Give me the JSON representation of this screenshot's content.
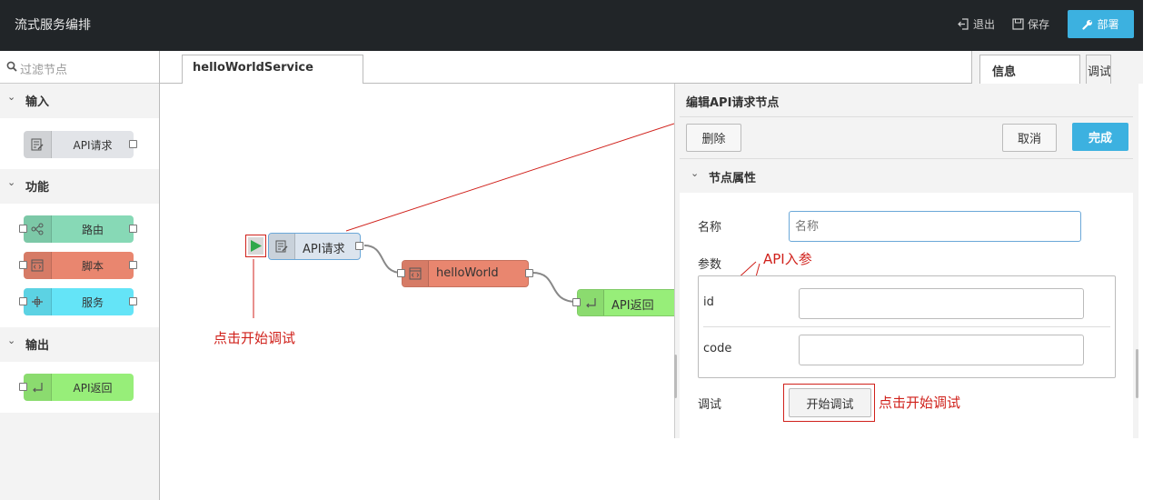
{
  "header": {
    "title": "流式服务编排",
    "logout_label": "退出",
    "save_label": "保存",
    "deploy_label": "部署"
  },
  "palette": {
    "filter_placeholder": "过滤节点",
    "categories": [
      {
        "label": "输入",
        "nodes": [
          {
            "label": "API请求",
            "icon": "api-request-icon",
            "color": "#e2e4e8"
          }
        ]
      },
      {
        "label": "功能",
        "nodes": [
          {
            "label": "路由",
            "icon": "route-icon",
            "color": "#87d9b6"
          },
          {
            "label": "脚本",
            "icon": "script-icon",
            "color": "#e9866f"
          },
          {
            "label": "服务",
            "icon": "service-icon",
            "color": "#64e4f7"
          }
        ]
      },
      {
        "label": "输出",
        "nodes": [
          {
            "label": "API返回",
            "icon": "api-return-icon",
            "color": "#97ee79"
          }
        ]
      }
    ]
  },
  "workspace": {
    "tab_label": "helloWorldService",
    "nodes": [
      {
        "label": "API请求",
        "color": "#dbe4ee"
      },
      {
        "label": "helloWorld",
        "color": "#e9866f"
      },
      {
        "label": "API返回",
        "color": "#97ee79"
      }
    ],
    "annotation_start": "点击开始调试"
  },
  "sidebar": {
    "tab_info": "信息",
    "tab_debug": "调试",
    "tray_title": "编辑API请求节点",
    "delete_label": "删除",
    "cancel_label": "取消",
    "done_label": "完成",
    "props_header": "节点属性",
    "name_label": "名称",
    "name_placeholder": "名称",
    "params_label": "参数",
    "params_annotation": "API入参",
    "params": [
      {
        "name": "id",
        "value": ""
      },
      {
        "name": "code",
        "value": ""
      }
    ],
    "debug_label": "调试",
    "start_debug_label": "开始调试",
    "start_debug_annotation": "点击开始调试"
  },
  "colors": {
    "header_bg": "#212528",
    "accent": "#3cb1e0",
    "annotation": "#d0211b"
  }
}
